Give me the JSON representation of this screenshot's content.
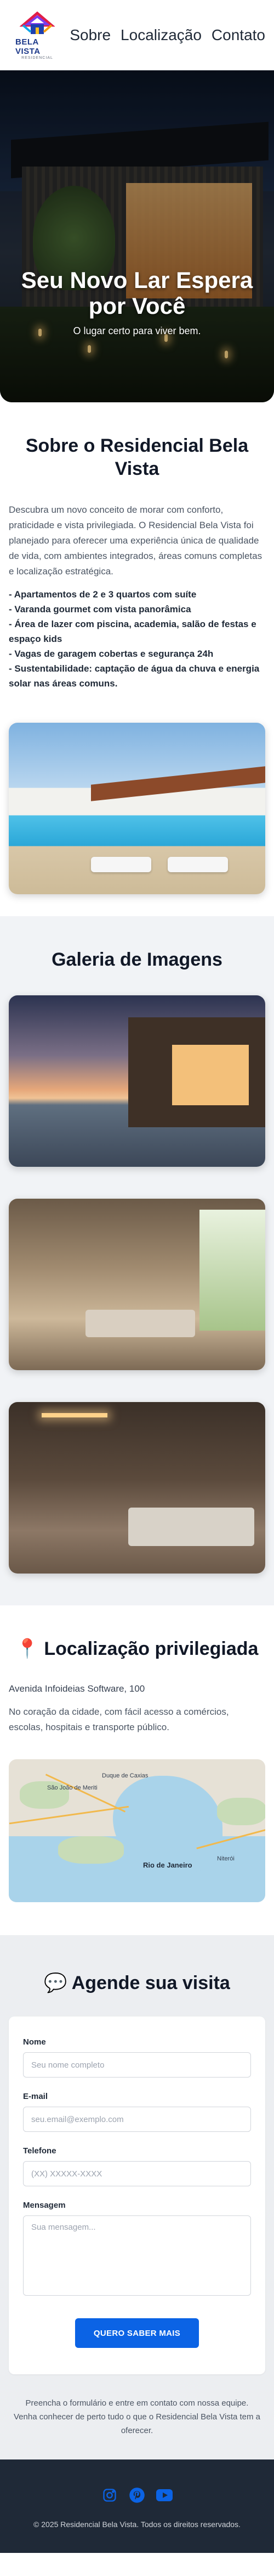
{
  "header": {
    "logo_text": "BELA VISTA",
    "logo_sub": "RESIDENCIAL",
    "nav": [
      {
        "label": "Sobre"
      },
      {
        "label": "Localização"
      },
      {
        "label": "Contato"
      }
    ]
  },
  "hero": {
    "title": "Seu Novo Lar Espera por Você",
    "subtitle": "O lugar certo para viver bem."
  },
  "about": {
    "title": "Sobre o Residencial Bela Vista",
    "paragraph": "Descubra um novo conceito de morar com conforto, praticidade e vista privilegiada. O Residencial Bela Vista foi planejado para oferecer uma experiência única de qualidade de vida, com ambientes integrados, áreas comuns completas e localização estratégica.",
    "features": [
      "- Apartamentos de 2 e 3 quartos com suíte",
      "- Varanda gourmet com vista panorâmica",
      "- Área de lazer com piscina, academia, salão de festas e espaço kids",
      "- Vagas de garagem cobertas e segurança 24h",
      "- Sustentabilidade: captação de água da chuva e energia solar nas áreas comuns."
    ]
  },
  "gallery": {
    "title": "Galeria de Imagens"
  },
  "location": {
    "icon": "pin-icon",
    "title": "Localização privilegiada",
    "address": "Avenida Infoideias Software, 100",
    "description": "No coração da cidade, com fácil acesso a comércios, escolas, hospitais e transporte público.",
    "map_labels": {
      "city": "Rio de Janeiro",
      "north": "São João de Meriti",
      "niteroi": "Niterói",
      "duque": "Duque de Caxias"
    }
  },
  "contact": {
    "icon": "chat-icon",
    "title": "Agende sua visita",
    "fields": {
      "name_label": "Nome",
      "name_placeholder": "Seu nome completo",
      "email_label": "E-mail",
      "email_placeholder": "seu.email@exemplo.com",
      "phone_label": "Telefone",
      "phone_placeholder": "(XX) XXXXX-XXXX",
      "message_label": "Mensagem",
      "message_placeholder": "Sua mensagem..."
    },
    "submit_label": "QUERO SABER MAIS",
    "note": "Preencha o formulário e entre em contato com nossa equipe. Venha conhecer de perto tudo o que o Residencial Bela Vista tem a oferecer."
  },
  "footer": {
    "socials": [
      "instagram-icon",
      "pinterest-icon",
      "youtube-icon"
    ],
    "social_color": "#0b63e5",
    "copyright": "© 2025 Residencial Bela Vista. Todos os direitos reservados."
  },
  "colors": {
    "accent": "#0b63e5",
    "footer_bg": "#1f2937",
    "gallery_bg": "#f1f3f6"
  }
}
